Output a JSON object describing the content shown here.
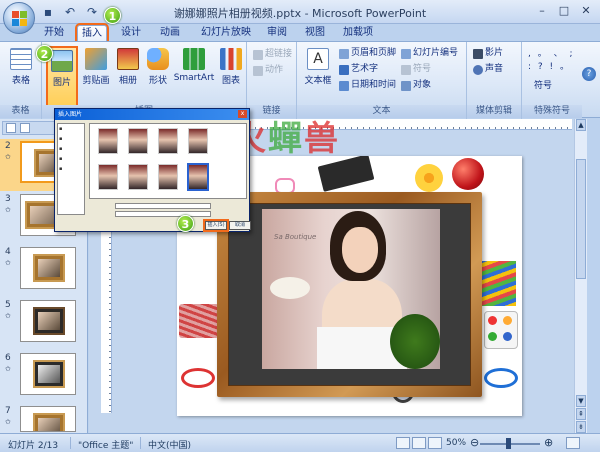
{
  "window": {
    "title": "谢娜娜照片相册视频.pptx - Microsoft PowerPoint"
  },
  "tabs": [
    {
      "label": "开始"
    },
    {
      "label": "插入"
    },
    {
      "label": "设计"
    },
    {
      "label": "动画"
    },
    {
      "label": "幻灯片放映"
    },
    {
      "label": "审阅"
    },
    {
      "label": "视图"
    },
    {
      "label": "加载项"
    }
  ],
  "steps": [
    "1",
    "2",
    "3"
  ],
  "ribbon": {
    "groups": {
      "tables": "表格",
      "illustrations": "插图",
      "links": "链接",
      "text": "文本",
      "media": "媒体剪辑",
      "symbols": "特殊符号"
    },
    "buttons": {
      "table": "表格",
      "picture": "图片",
      "clipart": "剪贴画",
      "album": "相册",
      "shapes": "形状",
      "smartart": "SmartArt",
      "chart": "图表",
      "hyperlink": "超链接",
      "action": "动作",
      "textbox": "文本框",
      "header_footer": "页眉和页脚",
      "wordart": "艺术字",
      "datetime": "日期和时间",
      "slide_number": "幻灯片编号",
      "symbol": "符号",
      "object": "对象",
      "movie": "影片",
      "sound": "声音",
      "symbol2": "符号"
    },
    "symbol_glyphs": ", 。 、 ; : ? ! 。"
  },
  "slides": [
    {
      "num": "2",
      "selected": true
    },
    {
      "num": "3",
      "selected": false
    },
    {
      "num": "4",
      "selected": false
    },
    {
      "num": "5",
      "selected": false
    },
    {
      "num": "6",
      "selected": false
    },
    {
      "num": "7",
      "selected": false
    }
  ],
  "dialog": {
    "title": "插入图片",
    "insert_label": "插入(S)",
    "cancel_label": "取消"
  },
  "watermark": {
    "part1": "火",
    "part2": "蟬",
    "part3": "兽"
  },
  "photo_sign": "Sa Boutique",
  "status": {
    "slide": "幻灯片 2/13",
    "theme": "\"Office 主题\"",
    "language": "中文(中国)",
    "zoom": "50%"
  },
  "colors": {
    "accent": "#f26a1b",
    "step_green": "#3c9f12"
  }
}
